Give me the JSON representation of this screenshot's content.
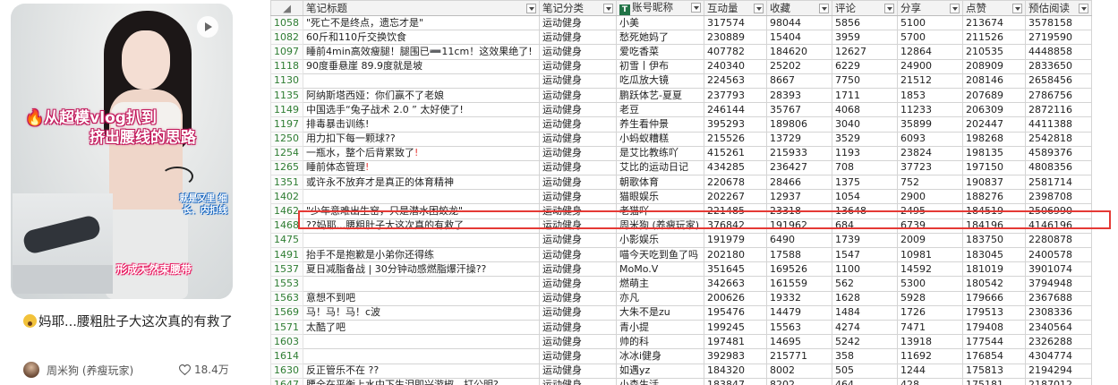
{
  "post": {
    "overlay_line1": "🔥从超模vlog扒到",
    "overlay_line2": "挤出腰线的思路",
    "overlay_side": "就是又里 细长、内扣线",
    "overlay_bottom": "形成天然束腰带",
    "title": "妈耶...腰粗肚子大这次真的有救了",
    "author": "周米狗 (养瘦玩家)",
    "likes": "18.4万"
  },
  "sheet": {
    "headers": [
      "笔记标题",
      "笔记分类",
      "账号昵称",
      "互动量",
      "收藏",
      "评论",
      "分享",
      "点赞",
      "预估阅读"
    ],
    "rows": [
      [
        "1058",
        "\"死亡不是终点，遗忘才是\"",
        "运动健身",
        "小美",
        "317574",
        "98044",
        "5856",
        "5100",
        "213674",
        "3578158"
      ],
      [
        "1082",
        "60斤和110斤交换饮食",
        "运动健身",
        "愁死她妈了",
        "230889",
        "15404",
        "3959",
        "5700",
        "211526",
        "2719590"
      ],
      [
        "1097",
        "睡前4min高效瘦腿！腿围已➖11cm！这效果绝了!",
        "运动健身",
        "爱吃香菜",
        "407782",
        "184620",
        "12627",
        "12864",
        "210535",
        "4448858"
      ],
      [
        "1118",
        "90度垂悬崖 89.9度就是坡",
        "运动健身",
        "初雪丨伊布",
        "240340",
        "25202",
        "6229",
        "24900",
        "208909",
        "2833650"
      ],
      [
        "1130",
        "",
        "运动健身",
        "吃瓜放大镜",
        "224563",
        "8667",
        "7750",
        "21512",
        "208146",
        "2658456"
      ],
      [
        "1135",
        "阿纳斯塔西娅：你们赢不了老娘",
        "运动健身",
        "鹏跃体艺-夏夏",
        "237793",
        "28393",
        "1711",
        "1853",
        "207689",
        "2786756"
      ],
      [
        "1149",
        "中国选手“兔子战术 2.0 ” 太好使了!",
        "运动健身",
        "老豆",
        "246144",
        "35767",
        "4068",
        "11233",
        "206309",
        "2872116"
      ],
      [
        "1197",
        "排毒暴击训练!",
        "运动健身",
        "养生看仲景",
        "395293",
        "189806",
        "3040",
        "35899",
        "202447",
        "4411388"
      ],
      [
        "1250",
        "用力扣下每一颗球??",
        "运动健身",
        "小蚂蚁糟糕",
        "215526",
        "13729",
        "3529",
        "6093",
        "198268",
        "2542818"
      ],
      [
        "1254",
        "一瓶水，整个后背累致了❗",
        "运动健身",
        "是艾比教练吖",
        "415261",
        "215933",
        "1193",
        "23824",
        "198135",
        "4589376"
      ],
      [
        "1265",
        "睡前体态管理❗",
        "运动健身",
        "艾比的运动日记",
        "434285",
        "236427",
        "708",
        "37723",
        "197150",
        "4808356"
      ],
      [
        "1351",
        "或许永不放弃才是真正的体育精神",
        "运动健身",
        "朝歌体育",
        "220678",
        "28466",
        "1375",
        "752",
        "190837",
        "2581714"
      ],
      [
        "1402",
        "",
        "运动健身",
        "猫眼娱乐",
        "202267",
        "12937",
        "1054",
        "2900",
        "188276",
        "2398708"
      ],
      [
        "1462",
        "\"少年意难出生窑，只是潜水困蛟龙\"",
        "运动健身",
        "老猫吖",
        "221485",
        "23318",
        "13648",
        "2495",
        "184519",
        "2506990"
      ],
      [
        "1468",
        "??妈耶...腰粗肚子大这次真的有救了",
        "运动健身",
        "周米狗 (养瘦玩家)",
        "376842",
        "191962",
        "684",
        "6739",
        "184196",
        "4146196"
      ],
      [
        "1475",
        "",
        "运动健身",
        "小影娱乐",
        "191979",
        "6490",
        "1739",
        "2009",
        "183750",
        "2280878"
      ],
      [
        "1491",
        "抬手不是抱歉是小弟你还得练",
        "运动健身",
        "喵今天吃到鱼了吗",
        "202180",
        "17588",
        "1547",
        "10981",
        "183045",
        "2400578"
      ],
      [
        "1537",
        "夏日减脂备战 | 30分钟动感燃脂爆汗操??",
        "运动健身",
        "MoMo.V",
        "351645",
        "169526",
        "1100",
        "14592",
        "181019",
        "3901074"
      ],
      [
        "1553",
        "",
        "运动健身",
        "燃萌主",
        "342663",
        "161559",
        "562",
        "5300",
        "180542",
        "3794948"
      ],
      [
        "1563",
        "意想不到吧",
        "运动健身",
        "亦凡",
        "200626",
        "19332",
        "1628",
        "5928",
        "179666",
        "2367688"
      ],
      [
        "1569",
        "马！马！马！c波",
        "运动健身",
        "大朱不是zu",
        "195476",
        "14479",
        "1484",
        "1726",
        "179513",
        "2308336"
      ],
      [
        "1571",
        "太酷了吧",
        "运动健身",
        "青小提",
        "199245",
        "15563",
        "4274",
        "7471",
        "179408",
        "2340564"
      ],
      [
        "1603",
        "",
        "运动健身",
        "帅的科",
        "197481",
        "14695",
        "5242",
        "13918",
        "177544",
        "2326288"
      ],
      [
        "1614",
        "",
        "运动健身",
        "冰冰i健身",
        "392983",
        "215771",
        "358",
        "11692",
        "176854",
        "4304774"
      ],
      [
        "1630",
        "反正管乐不在 ??",
        "运动健身",
        "如遇yz",
        "184320",
        "8002",
        "505",
        "1244",
        "175813",
        "2194294"
      ],
      [
        "1647",
        "腰全在平衡上水中下生泪即兴游椒，打公明?",
        "运动健身",
        "小森生活",
        "183847",
        "8202",
        "464",
        "428",
        "175181",
        "2187012"
      ]
    ]
  },
  "colors": {
    "highlight": "#e53935",
    "row_number": "#2e7d32",
    "grid": "#d4d4d4"
  }
}
